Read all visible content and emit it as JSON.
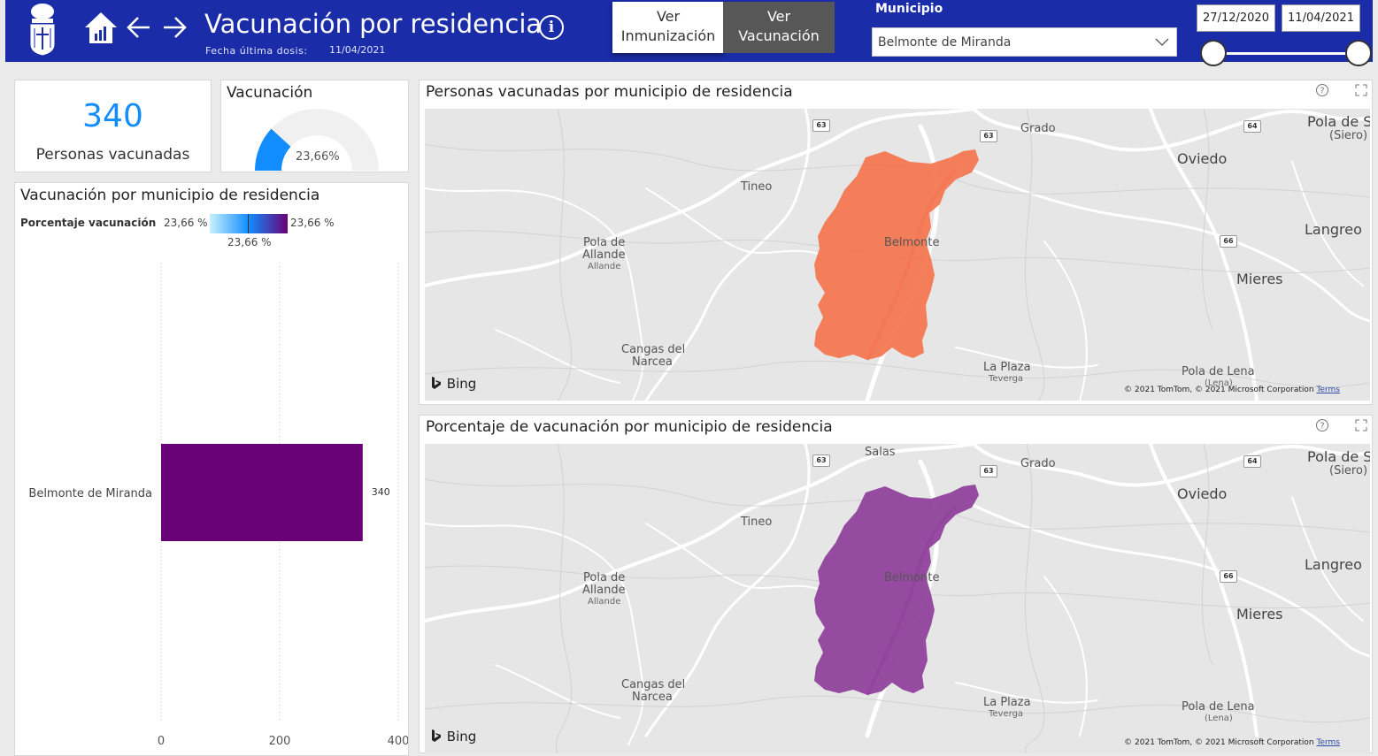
{
  "header": {
    "title": "Vacunación por residencia",
    "subtitle_label": "Fecha última dosis:",
    "subtitle_date": "11/04/2021",
    "info_icon": "i",
    "btn_inmunizacion": [
      "Ver",
      "Inmunización"
    ],
    "btn_vacunacion": [
      "Ver",
      "Vacunación"
    ],
    "municipio_label": "Municipio",
    "municipio_value": "Belmonte de Miranda",
    "date_start": "27/12/2020",
    "date_end": "11/04/2021"
  },
  "kpi": {
    "value": "340",
    "label": "Personas vacunadas"
  },
  "gauge": {
    "title": "Vacunación",
    "value_label": "23,66%",
    "fraction": 0.2366,
    "color": "#118dff",
    "track_color": "#f0f0f0"
  },
  "bar_card": {
    "title": "Vacunación por municipio de residencia",
    "legend_title": "Porcentaje vacunación",
    "legend_min": "23,66 %",
    "legend_max": "23,66 %",
    "legend_mid": "23,66 %"
  },
  "chart_data": {
    "type": "bar",
    "orientation": "horizontal",
    "categories": [
      "Belmonte de Miranda"
    ],
    "values": [
      340
    ],
    "data_labels": [
      "340"
    ],
    "xticks": [
      "0",
      "200",
      "400"
    ],
    "xlim": [
      0,
      400
    ],
    "bar_color": "#6a0075",
    "grid": true
  },
  "map1": {
    "title": "Personas vacunadas por municipio de residencia",
    "region_color": "#f4744f"
  },
  "map2": {
    "title": "Porcentaje de vacunación por municipio de residencia",
    "region_color": "#8e3f9a"
  },
  "map_labels": {
    "grado": "Grado",
    "pola_siero_1": "Pola de Si",
    "pola_siero_2": "(Siero)",
    "oviedo": "Oviedo",
    "tineo": "Tineo",
    "langreo": "Langreo",
    "pola_allande_1": "Pola de",
    "pola_allande_2": "Allande",
    "pola_allande_3": "Allande",
    "belmonte": "Belmonte",
    "mieres": "Mieres",
    "cangas_1": "Cangas del",
    "cangas_2": "Narcea",
    "la_plaza": "La Plaza",
    "teverga": "Teverga",
    "pola_lena": "Pola de Lena",
    "lena": "(Lena)",
    "salas": "Salas",
    "road_63": "63",
    "road_64": "64",
    "road_66": "66"
  },
  "map_footer": {
    "bing": "Bing",
    "copyright": "© 2021 TomTom, © 2021 Microsoft Corporation",
    "terms": "Terms"
  },
  "icons": {
    "help": "?",
    "focus": "expand-icon"
  }
}
